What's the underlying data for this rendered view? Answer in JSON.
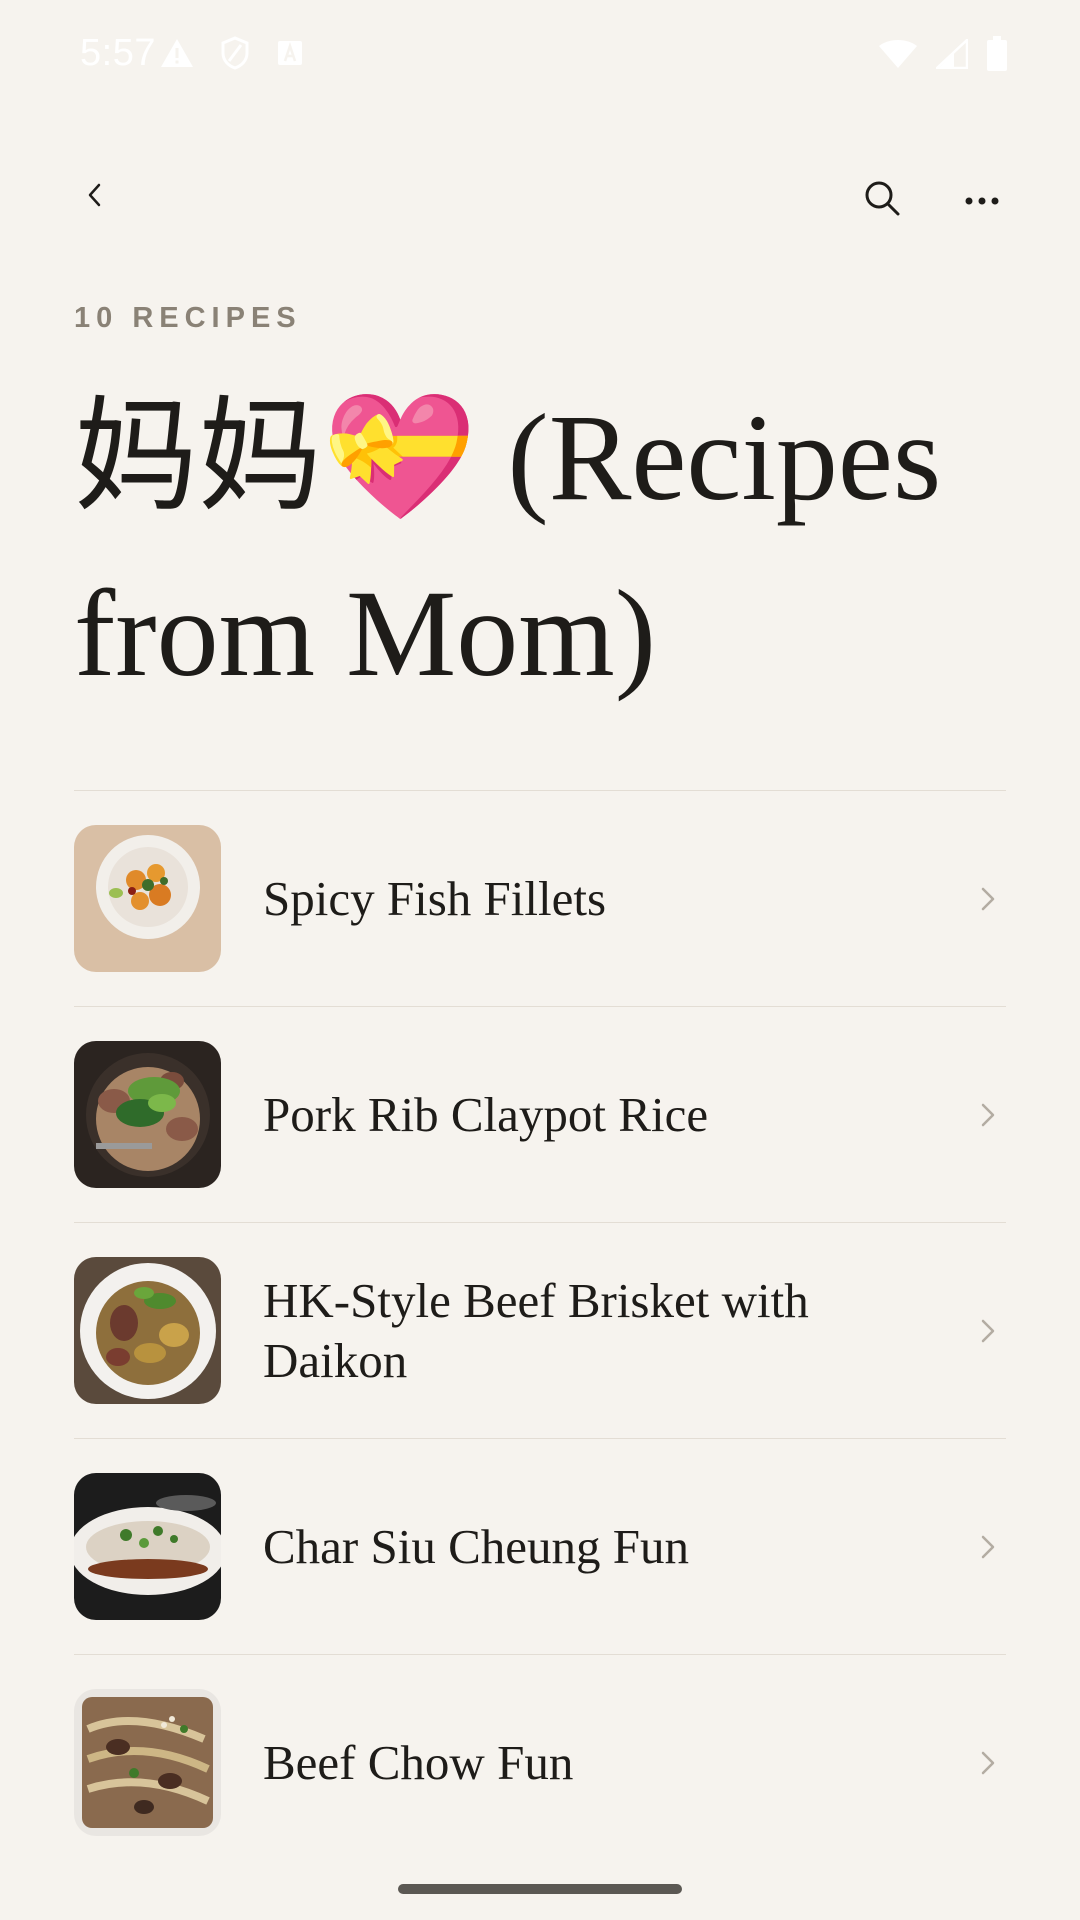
{
  "status_bar": {
    "time": "5:57",
    "left_icons": [
      "warning-icon",
      "shield-icon",
      "font-icon"
    ],
    "right_icons": [
      "wifi-icon",
      "signal-icon",
      "battery-icon"
    ]
  },
  "app_bar": {
    "back_icon": "chevron-left-icon",
    "search_icon": "search-icon",
    "more_icon": "more-horizontal-icon"
  },
  "collection": {
    "count_label": "10 RECIPES",
    "title": "妈妈💝 (Recipes from Mom)"
  },
  "recipes": [
    {
      "name": "Spicy Fish Fillets"
    },
    {
      "name": "Pork Rib Claypot Rice"
    },
    {
      "name": "HK-Style Beef Brisket with Daikon"
    },
    {
      "name": "Char Siu Cheung Fun"
    },
    {
      "name": "Beef Chow Fun"
    }
  ],
  "colors": {
    "background": "#f6f3ee",
    "text": "#1e1c19",
    "muted": "#8a8276",
    "divider": "#e3ddd4"
  }
}
